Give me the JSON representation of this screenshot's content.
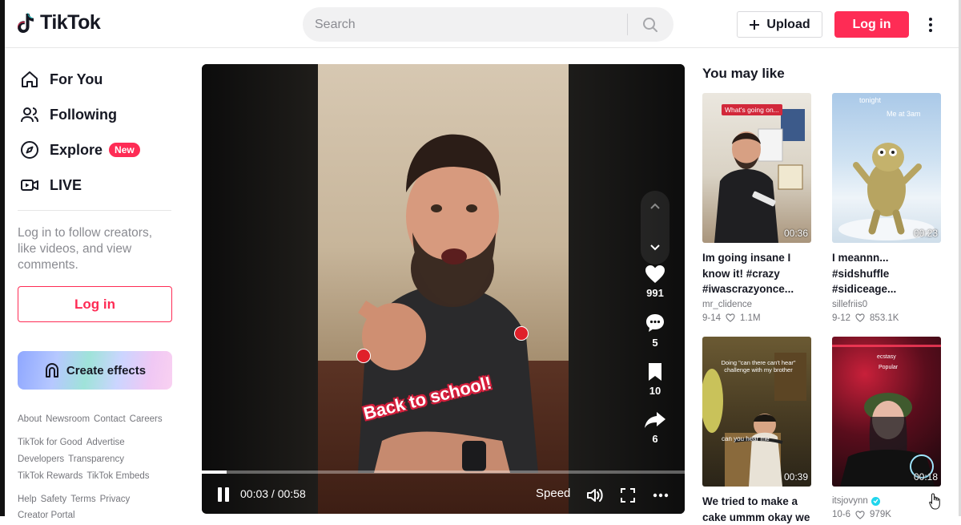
{
  "header": {
    "logo_text": "TikTok",
    "search_placeholder": "Search",
    "upload_label": "Upload",
    "login_label": "Log in"
  },
  "sidebar": {
    "nav": [
      {
        "label": "For You",
        "icon": "home-icon"
      },
      {
        "label": "Following",
        "icon": "following-icon"
      },
      {
        "label": "Explore",
        "icon": "compass-icon",
        "badge": "New"
      },
      {
        "label": "LIVE",
        "icon": "live-icon"
      }
    ],
    "login_hint": "Log in to follow creators, like videos, and view comments.",
    "login_label": "Log in",
    "effects_label": "Create effects",
    "footer_rows": [
      [
        "About",
        "Newsroom",
        "Contact",
        "Careers"
      ],
      [
        "TikTok for Good",
        "Advertise"
      ],
      [
        "Developers",
        "Transparency"
      ],
      [
        "TikTok Rewards",
        "TikTok Embeds"
      ],
      [
        "Help",
        "Safety",
        "Terms",
        "Privacy"
      ],
      [
        "Creator Portal"
      ]
    ]
  },
  "video": {
    "caption": "Back to school!",
    "likes": "991",
    "comments": "5",
    "saves": "10",
    "shares": "6",
    "time_display": "00:03 / 00:58",
    "progress": 0.052,
    "speed_label": "Speed"
  },
  "recommendations": {
    "title": "You may like",
    "items": [
      {
        "title": "Im going insane I know it! #crazy #iwascrazyonce...",
        "author": "mr_clidence",
        "date": "9-14",
        "likes": "1.1M",
        "duration": "00:36",
        "overlay": "What's going on..."
      },
      {
        "title": "I meannn... #sidshuffle #sidiceage...",
        "author": "sillefriis0",
        "date": "9-12",
        "likes": "853.1K",
        "duration": "00:23",
        "overlay": "tonight",
        "overlay2": "Me at 3am"
      },
      {
        "title": "We tried to make a cake ummm okay we",
        "author": "",
        "date": "",
        "likes": "",
        "duration": "00:39",
        "overlay": "Doing \"can there can't hear\" challenge with my brother",
        "overlay2": "can you hear me"
      },
      {
        "title": "",
        "author": "itsjovynn",
        "date": "10-6",
        "likes": "979K",
        "duration": "00:18",
        "overlay": "ecstasy",
        "overlay2": "Popular"
      }
    ]
  },
  "colors": {
    "brand": "#fe2c55",
    "text": "#161823",
    "muted": "#8a8b91"
  }
}
